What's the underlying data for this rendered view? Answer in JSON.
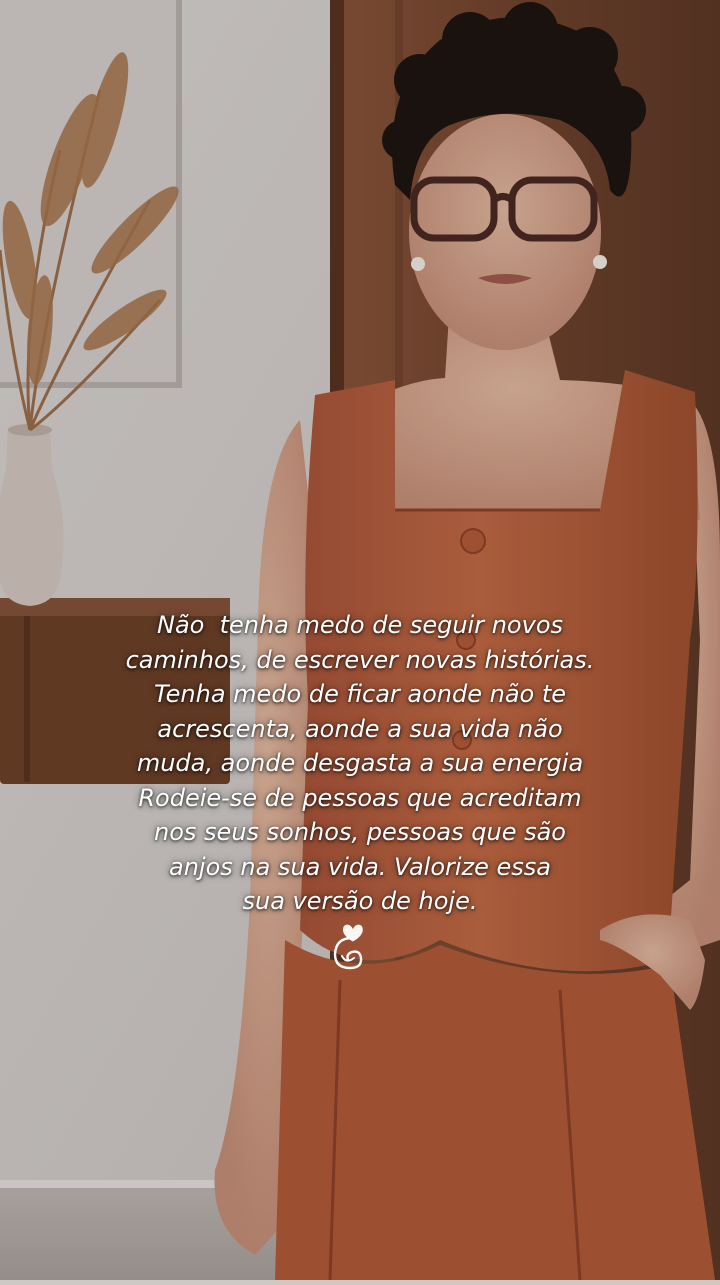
{
  "caption": {
    "lines": [
      "Não  tenha medo de seguir novos",
      "caminhos, de escrever novas histórias.",
      "Tenha medo de ficar aonde não te",
      "acrescenta, aonde a sua vida não",
      "muda, aonde desgasta a sua energia",
      "Rodeie-se de pessoas que acreditam",
      "nos seus sonhos, pessoas que são",
      "anjos na sua vida. Valorize essa",
      "sua versão de hoje."
    ],
    "text_color": "#ffffff"
  },
  "decoration": {
    "icon": "heart-swirl-icon"
  },
  "palette": {
    "outfit": "#b4603d",
    "wall": "#d9d3d0",
    "door": "#7a4a33"
  }
}
